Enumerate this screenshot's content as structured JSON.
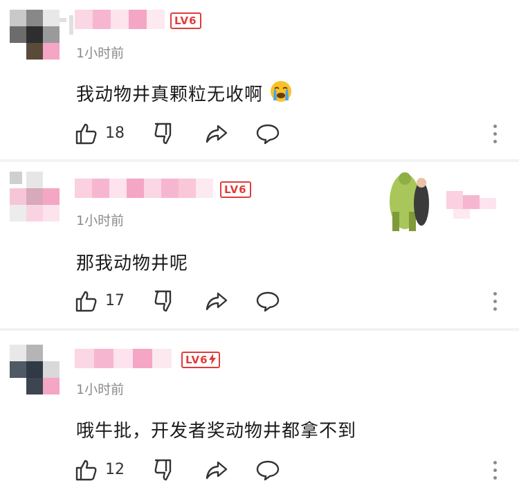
{
  "comments": [
    {
      "level": "LV6",
      "time": "1小时前",
      "text": "我动物井真颗粒无收啊",
      "emoji": "loudly-crying-face",
      "likes": "18"
    },
    {
      "level": "LV6",
      "time": "1小时前",
      "text": "那我动物井呢",
      "likes": "17"
    },
    {
      "level": "LV6",
      "time": "1小时前",
      "text": "哦牛批，开发者奖动物井都拿不到",
      "likes": "12",
      "badge_extra": "lightning"
    }
  ],
  "colors": {
    "level_badge": "#e23a3a",
    "time_text": "#8a8a8a",
    "icon_stroke": "#333333",
    "mosaic_pink": "#f7b6cf",
    "divider": "#f2f2f2"
  },
  "icons": [
    "thumbs-up-icon",
    "thumbs-down-icon",
    "share-icon",
    "reply-icon",
    "more-vertical-icon",
    "loudly-crying-face-icon",
    "lightning-icon"
  ]
}
